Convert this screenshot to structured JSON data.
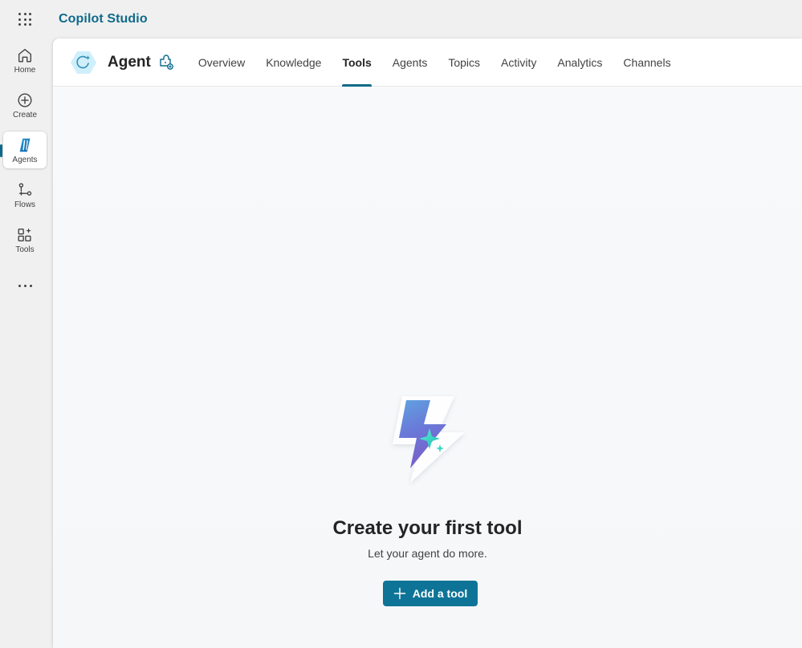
{
  "app": {
    "title": "Copilot Studio"
  },
  "rail": {
    "items": [
      {
        "label": "Home",
        "icon": "home-icon"
      },
      {
        "label": "Create",
        "icon": "plus-circle-icon"
      },
      {
        "label": "Agents",
        "icon": "agents-icon",
        "active": true
      },
      {
        "label": "Flows",
        "icon": "flows-icon"
      },
      {
        "label": "Tools",
        "icon": "tools-icon"
      }
    ],
    "more_icon": "more-horizontal-icon"
  },
  "agent": {
    "name": "Agent",
    "icon": "agent-hexagon-icon",
    "edit_icon": "agent-settings-icon"
  },
  "tabs": [
    {
      "label": "Overview"
    },
    {
      "label": "Knowledge"
    },
    {
      "label": "Tools",
      "active": true
    },
    {
      "label": "Agents"
    },
    {
      "label": "Topics"
    },
    {
      "label": "Activity"
    },
    {
      "label": "Analytics"
    },
    {
      "label": "Channels"
    }
  ],
  "empty_state": {
    "illustration": "lightning-sparkle-icon",
    "title": "Create your first tool",
    "subtitle": "Let your agent do more.",
    "button_label": "Add a tool",
    "button_icon": "plus-icon"
  },
  "colors": {
    "accent": "#0e6a8a",
    "button": "#0e7497"
  }
}
